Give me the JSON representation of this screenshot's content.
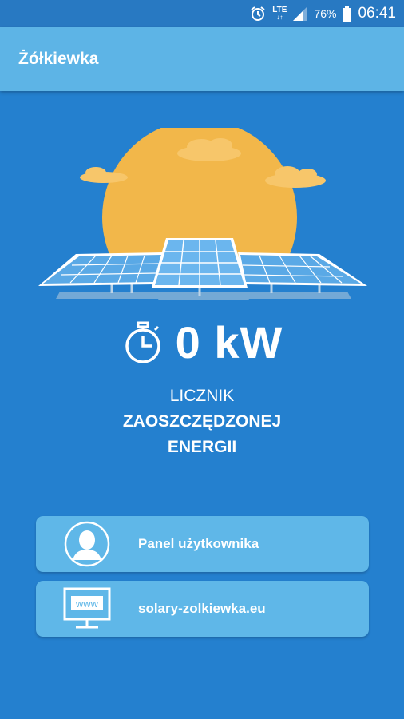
{
  "status_bar": {
    "network": "LTE",
    "battery": "76%",
    "time": "06:41"
  },
  "app_bar": {
    "title": "Żółkiewka"
  },
  "counter": {
    "value": "0 kW",
    "caption_line1": "LICZNIK",
    "caption_line2": "ZAOSZCZĘDZONEJ",
    "caption_line3": "ENERGII"
  },
  "actions": [
    {
      "label": "Panel użytkownika",
      "icon": "user-profile-icon"
    },
    {
      "label": "solary-zolkiewka.eu",
      "icon": "www-monitor-icon",
      "icon_text": "www"
    }
  ],
  "colors": {
    "background": "#2480cf",
    "app_bar": "#5db4e6",
    "button": "#5fb7e8",
    "sun": "#f2b74a"
  }
}
